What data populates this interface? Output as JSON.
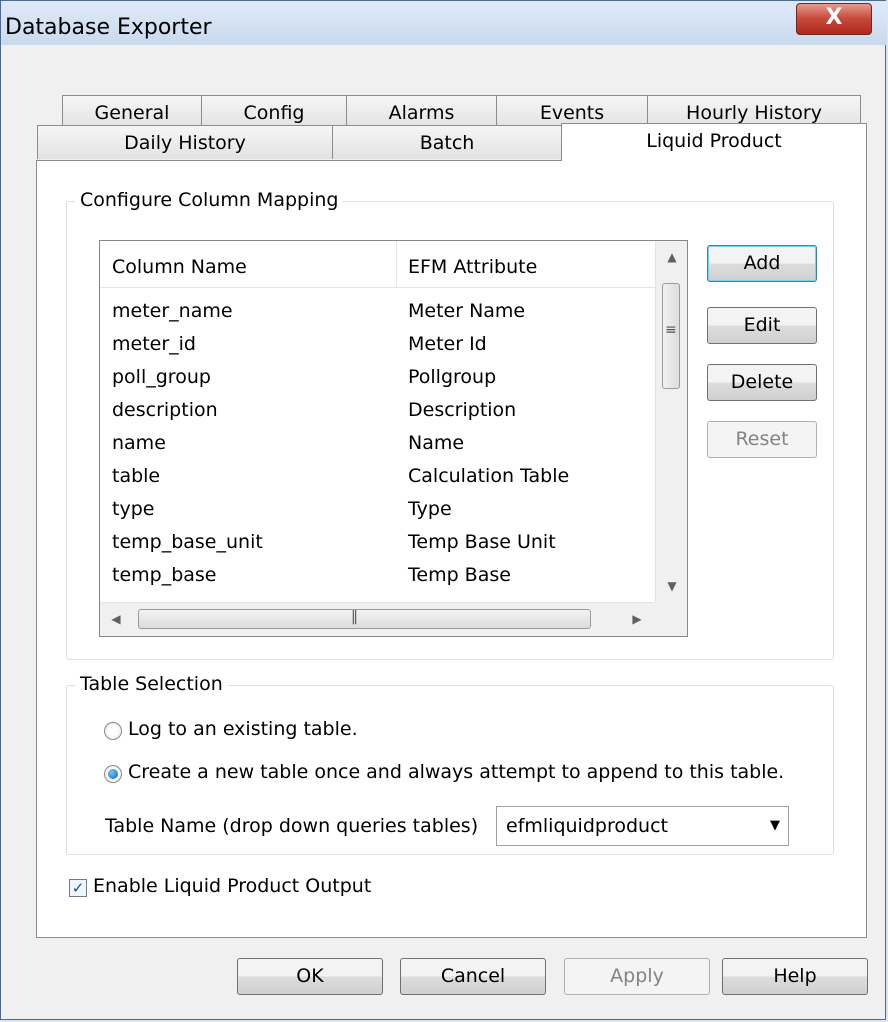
{
  "window": {
    "title": "Database Exporter"
  },
  "close_label": "X",
  "tabs_row1": [
    "General",
    "Config",
    "Alarms",
    "Events",
    "Hourly History"
  ],
  "tabs_row2": [
    "Daily History",
    "Batch",
    "Liquid Product"
  ],
  "active_tab": "Liquid Product",
  "mapping": {
    "group_title": "Configure Column Mapping",
    "headers": [
      "Column Name",
      "EFM Attribute"
    ],
    "rows": [
      [
        "meter_name",
        "Meter Name"
      ],
      [
        "meter_id",
        "Meter Id"
      ],
      [
        "poll_group",
        "Pollgroup"
      ],
      [
        "description",
        "Description"
      ],
      [
        "name",
        "Name"
      ],
      [
        "table",
        "Calculation Table"
      ],
      [
        "type",
        "Type"
      ],
      [
        "temp_base_unit",
        "Temp Base Unit"
      ],
      [
        "temp_base",
        "Temp Base"
      ]
    ],
    "buttons": {
      "add": "Add",
      "edit": "Edit",
      "delete": "Delete",
      "reset": "Reset"
    }
  },
  "table_selection": {
    "group_title": "Table Selection",
    "option_existing": "Log to an existing table.",
    "option_create": "Create a new table once and always attempt to append to this table.",
    "selected_option": "create",
    "table_name_label": "Table Name (drop down queries tables)",
    "table_name_value": "efmliquidproduct"
  },
  "enable_output": {
    "label": "Enable Liquid Product Output",
    "checked": true
  },
  "footer_buttons": {
    "ok": "OK",
    "cancel": "Cancel",
    "apply": "Apply",
    "help": "Help"
  },
  "colors": {
    "accent": "#3c7fb1",
    "close": "#c6473b",
    "titlebar": "#dfeaf7"
  }
}
